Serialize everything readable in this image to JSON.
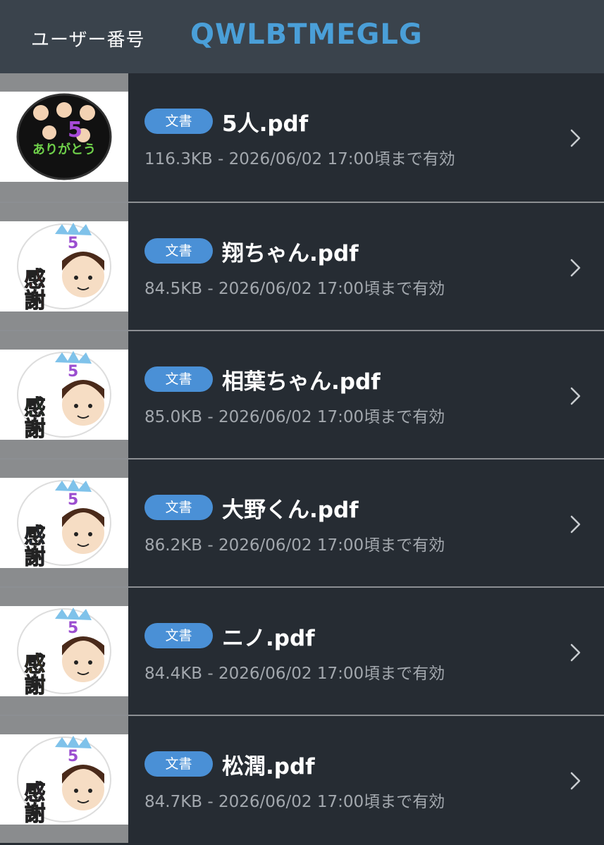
{
  "header": {
    "label": "ユーザー番号",
    "user_code": "QWLBTMEGLG"
  },
  "files": [
    {
      "badge": "文書",
      "name": "5人.pdf",
      "meta": "116.3KB - 2026/06/02 17:00頃まで有効",
      "accent": "#6fd04a",
      "text": "ありがとう"
    },
    {
      "badge": "文書",
      "name": "翔ちゃん.pdf",
      "meta": "84.5KB - 2026/06/02 17:00頃まで有効",
      "accent": "#e0463a",
      "text": "感謝"
    },
    {
      "badge": "文書",
      "name": "相葉ちゃん.pdf",
      "meta": "85.0KB - 2026/06/02 17:00頃まで有効",
      "accent": "#3fa54a",
      "text": "感謝"
    },
    {
      "badge": "文書",
      "name": "大野くん.pdf",
      "meta": "86.2KB - 2026/06/02 17:00頃まで有効",
      "accent": "#3a72c8",
      "text": "感謝"
    },
    {
      "badge": "文書",
      "name": "ニノ.pdf",
      "meta": "84.4KB - 2026/06/02 17:00頃まで有効",
      "accent": "#f0c020",
      "text": "感謝"
    },
    {
      "badge": "文書",
      "name": "松潤.pdf",
      "meta": "84.7KB - 2026/06/02 17:00頃まで有効",
      "accent": "#8a3fb0",
      "text": "感謝"
    }
  ]
}
